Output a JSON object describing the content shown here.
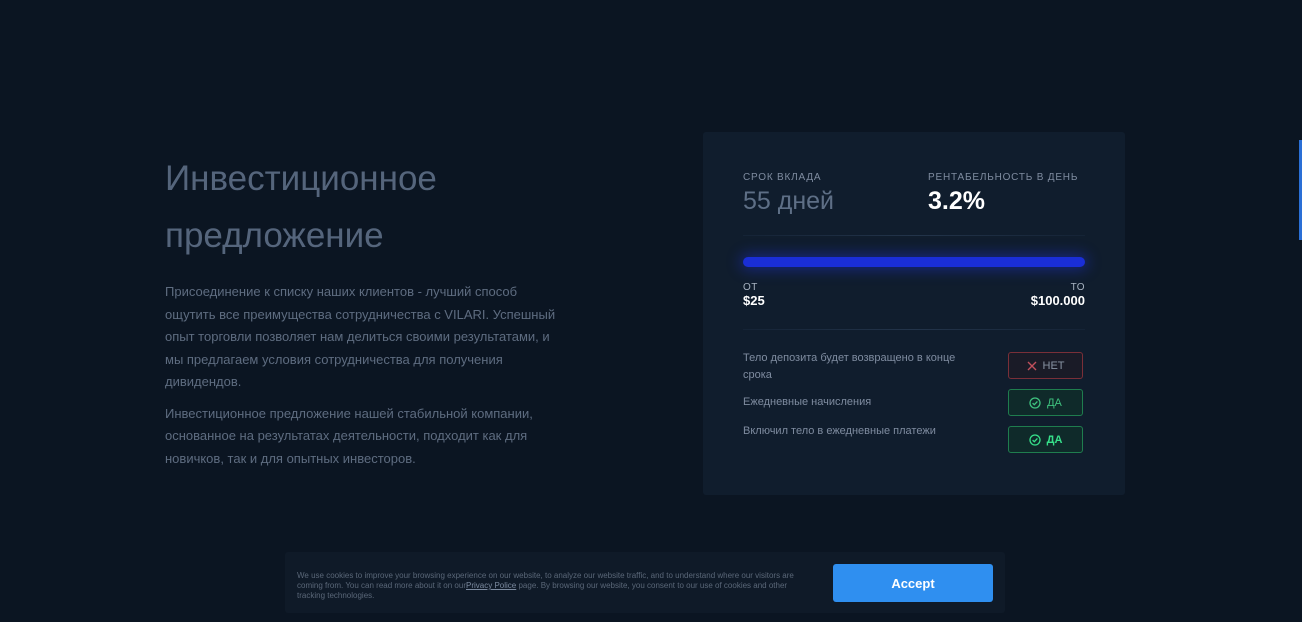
{
  "offer": {
    "title_line1": "Инвестиционное",
    "title_line2": "предложение",
    "paragraph1": "Присоединение к списку наших клиентов - лучший способ ощутить все преимущества сотрудничества с VILARI. Успешный опыт торговли позволяет нам делиться своими результатами, и мы предлагаем условия сотрудничества для получения дивидендов.",
    "paragraph2": "Инвестиционное предложение нашей стабильной компании, основанное на результатах деятельности, подходит как для новичков, так и для опытных инвесторов."
  },
  "card": {
    "term_label": "СРОК ВКЛАДА",
    "term_value": "55 дней",
    "profit_label": "РЕНТАБЕЛЬНОСТЬ В ДЕНЬ",
    "profit_value": "3.2%",
    "range": {
      "from_label": "ОТ",
      "from_value": "$25",
      "to_label": "ТО",
      "to_value": "$100.000",
      "fill_percent": 100
    },
    "conditions": [
      {
        "text": "Тело депозита будет возвращено в конце срока",
        "badge": "НЕТ",
        "status": "no"
      },
      {
        "text": "Ежедневные начисления",
        "badge": "ДА",
        "status": "yes"
      },
      {
        "text": "Включил тело в ежедневные платежи",
        "badge": "ДА",
        "status": "yes"
      }
    ]
  },
  "cookie": {
    "text_before_link": "We use cookies to improve your browsing experience on our website, to analyze our website traffic, and to understand where our visitors are coming from. You can read more about it on our",
    "link_text": "Privacy Police",
    "text_after_link": " page. By browsing our website, you consent to our use of cookies and other tracking technologies.",
    "accept_label": "Accept"
  },
  "colors": {
    "background": "#0b1522",
    "card": "#101d2d",
    "accent_blue": "#2f8ff0",
    "range_fill": "#1a2ed6",
    "yes_green": "#3fc27f",
    "no_red": "#7a2f38"
  },
  "icons": {
    "no_badge": "x-icon",
    "yes_badge": "check-circle-icon"
  }
}
